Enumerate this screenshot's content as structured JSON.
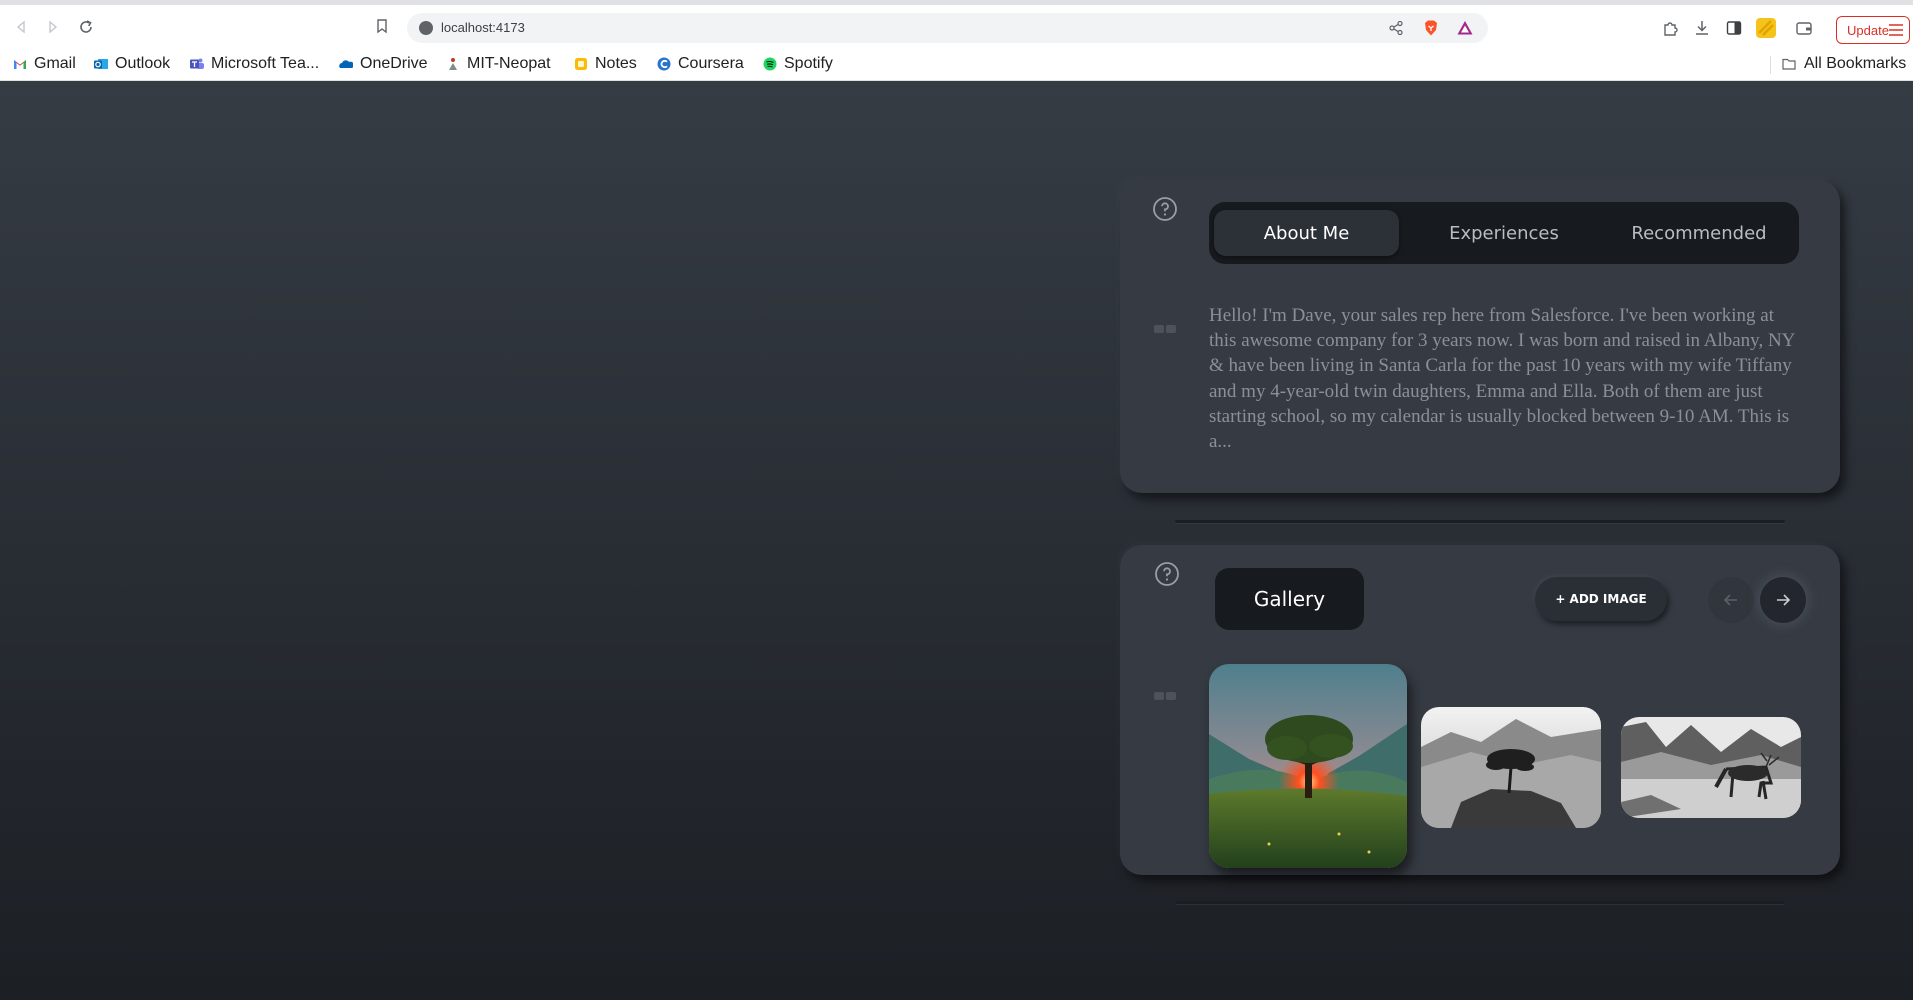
{
  "browser": {
    "url": "localhost:4173",
    "update_label": "Update",
    "bookmarks": [
      {
        "label": "Gmail",
        "icon": "gmail-icon"
      },
      {
        "label": "Outlook",
        "icon": "outlook-icon"
      },
      {
        "label": "Microsoft Tea...",
        "icon": "teams-icon"
      },
      {
        "label": "OneDrive",
        "icon": "onedrive-icon"
      },
      {
        "label": "MIT-Neopat",
        "icon": "neopat-icon"
      },
      {
        "label": "Notes",
        "icon": "notes-icon"
      },
      {
        "label": "Coursera",
        "icon": "coursera-icon"
      },
      {
        "label": "Spotify",
        "icon": "spotify-icon"
      }
    ],
    "all_bookmarks_label": "All Bookmarks"
  },
  "about_card": {
    "tabs": [
      {
        "label": "About Me",
        "active": true
      },
      {
        "label": "Experiences",
        "active": false
      },
      {
        "label": "Recommended",
        "active": false
      }
    ],
    "text": "Hello! I'm Dave, your sales rep here from Salesforce. I've been working at this awesome company for 3 years now. I was born and raised in Albany, NY & have been living in Santa Carla for the past 10 years with my wife Tiffany and my 4-year-old twin daughters, Emma and Ella. Both of them are just starting school, so my calendar is usually blocked between 9-10 AM. This is a..."
  },
  "gallery_card": {
    "title": "Gallery",
    "add_button_label": "+ ADD IMAGE",
    "images": [
      {
        "icon": "tree-sunset-image"
      },
      {
        "icon": "tree-rock-bw-image"
      },
      {
        "icon": "deer-lake-bw-image"
      }
    ]
  },
  "colors": {
    "page_bg_top": "#363c44",
    "page_bg_bottom": "#1c1f24",
    "card_bg": "#363b43",
    "pill_bg": "#171a1e",
    "text_muted": "#8c9096",
    "update_red": "#d93025"
  }
}
